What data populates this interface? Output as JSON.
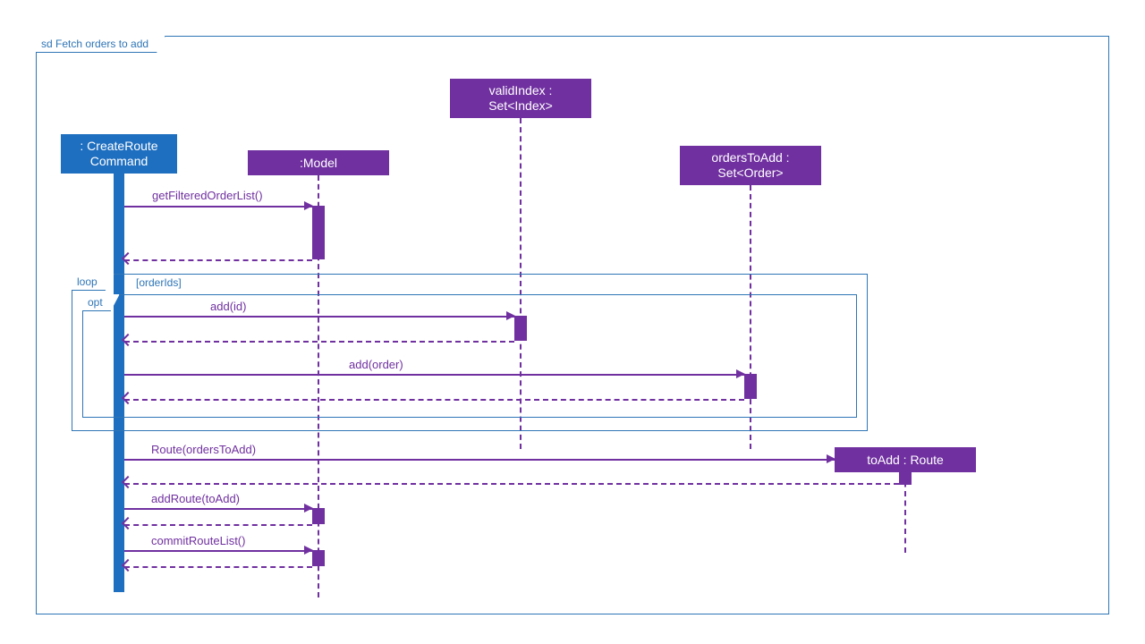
{
  "frame": {
    "title": "sd Fetch orders to add",
    "loopLabel": "loop",
    "loopGuard": "[orderIds]",
    "optLabel": "opt"
  },
  "lifelines": {
    "createRoute": {
      "line1": ": CreateRoute",
      "line2": "Command"
    },
    "model": ":Model",
    "validIndex": {
      "line1": "validIndex :",
      "line2": "Set<Index>"
    },
    "ordersToAdd": {
      "line1": "ordersToAdd :",
      "line2": "Set<Order>"
    },
    "toAdd": "toAdd : Route"
  },
  "messages": {
    "getFilteredOrderList": "getFilteredOrderList()",
    "addId": "add(id)",
    "addOrder": "add(order)",
    "routeOrders": "Route(ordersToAdd)",
    "addRoute": "addRoute(toAdd)",
    "commitRouteList": "commitRouteList()"
  }
}
